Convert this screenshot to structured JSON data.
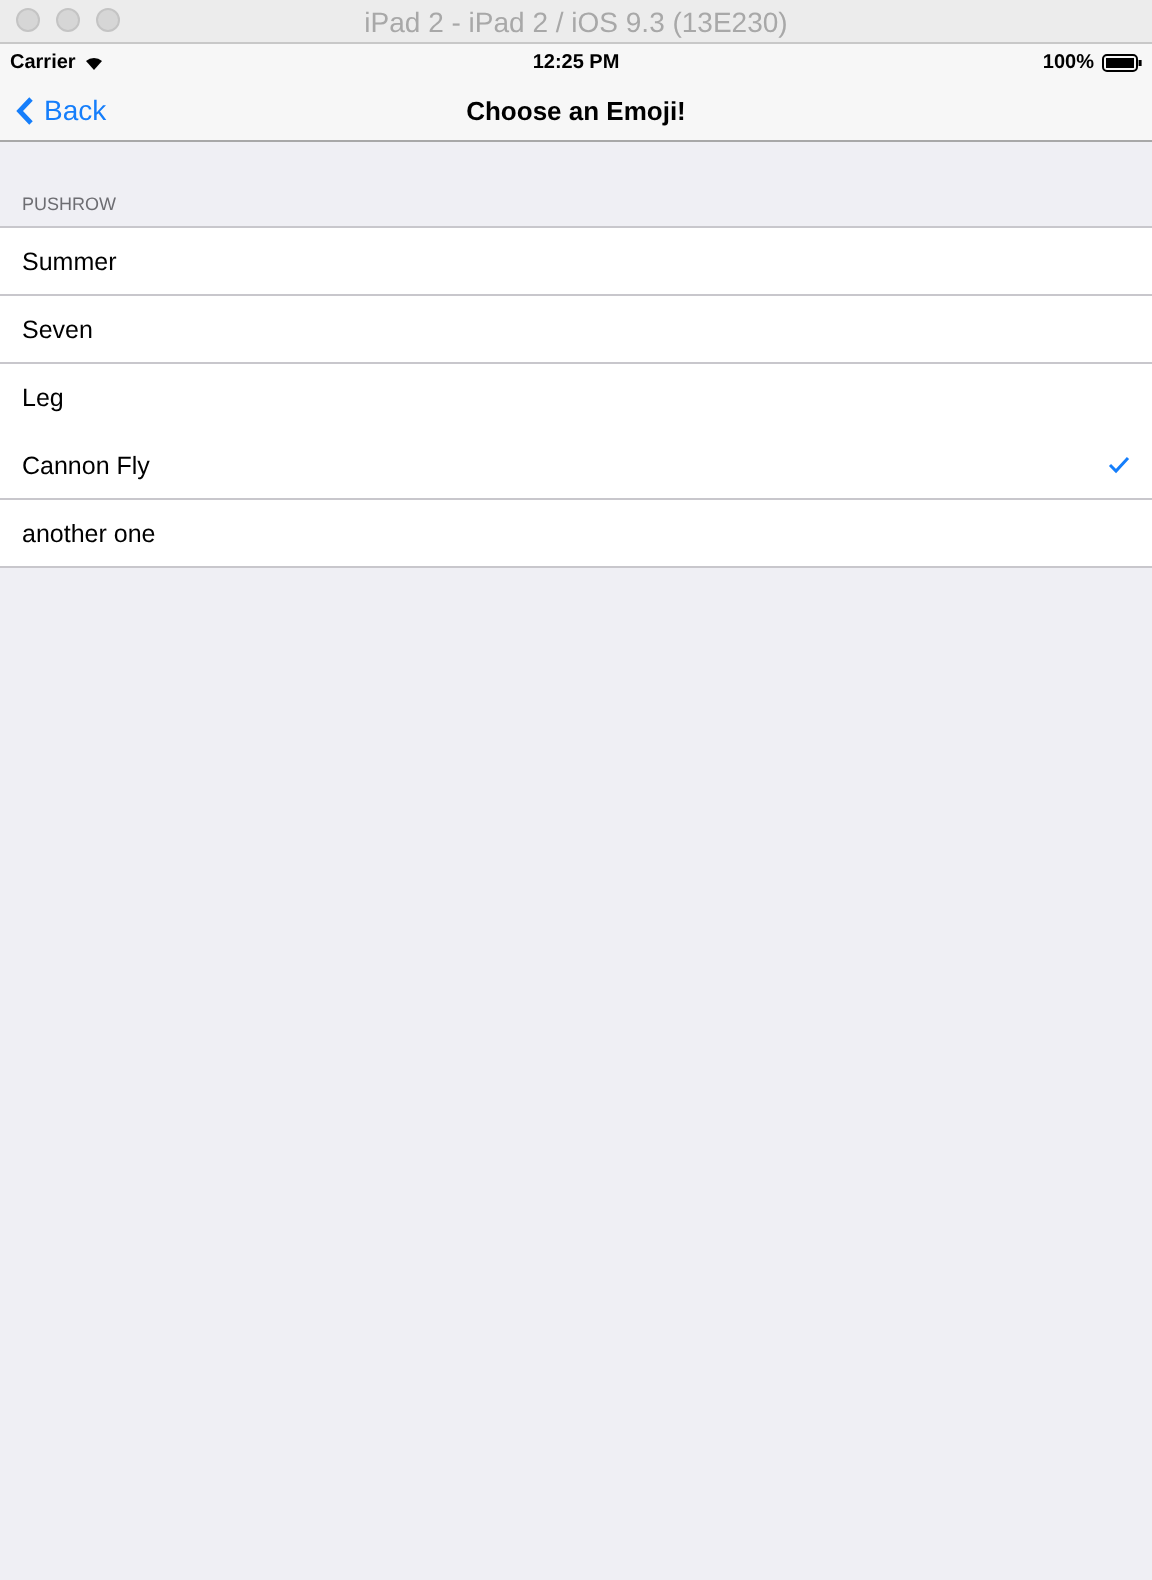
{
  "window": {
    "title": "iPad 2 - iPad 2 / iOS 9.3 (13E230)"
  },
  "status_bar": {
    "carrier": "Carrier",
    "time": "12:25 PM",
    "battery": "100%"
  },
  "nav_bar": {
    "back": "Back",
    "title": "Choose an Emoji!"
  },
  "section": {
    "header": "PUSHROW",
    "rows": [
      {
        "label": "Summer",
        "selected": false
      },
      {
        "label": "Seven",
        "selected": false
      },
      {
        "label": "Leg",
        "selected": false
      },
      {
        "label": "Cannon Fly",
        "selected": true
      },
      {
        "label": "another one",
        "selected": false
      }
    ]
  }
}
